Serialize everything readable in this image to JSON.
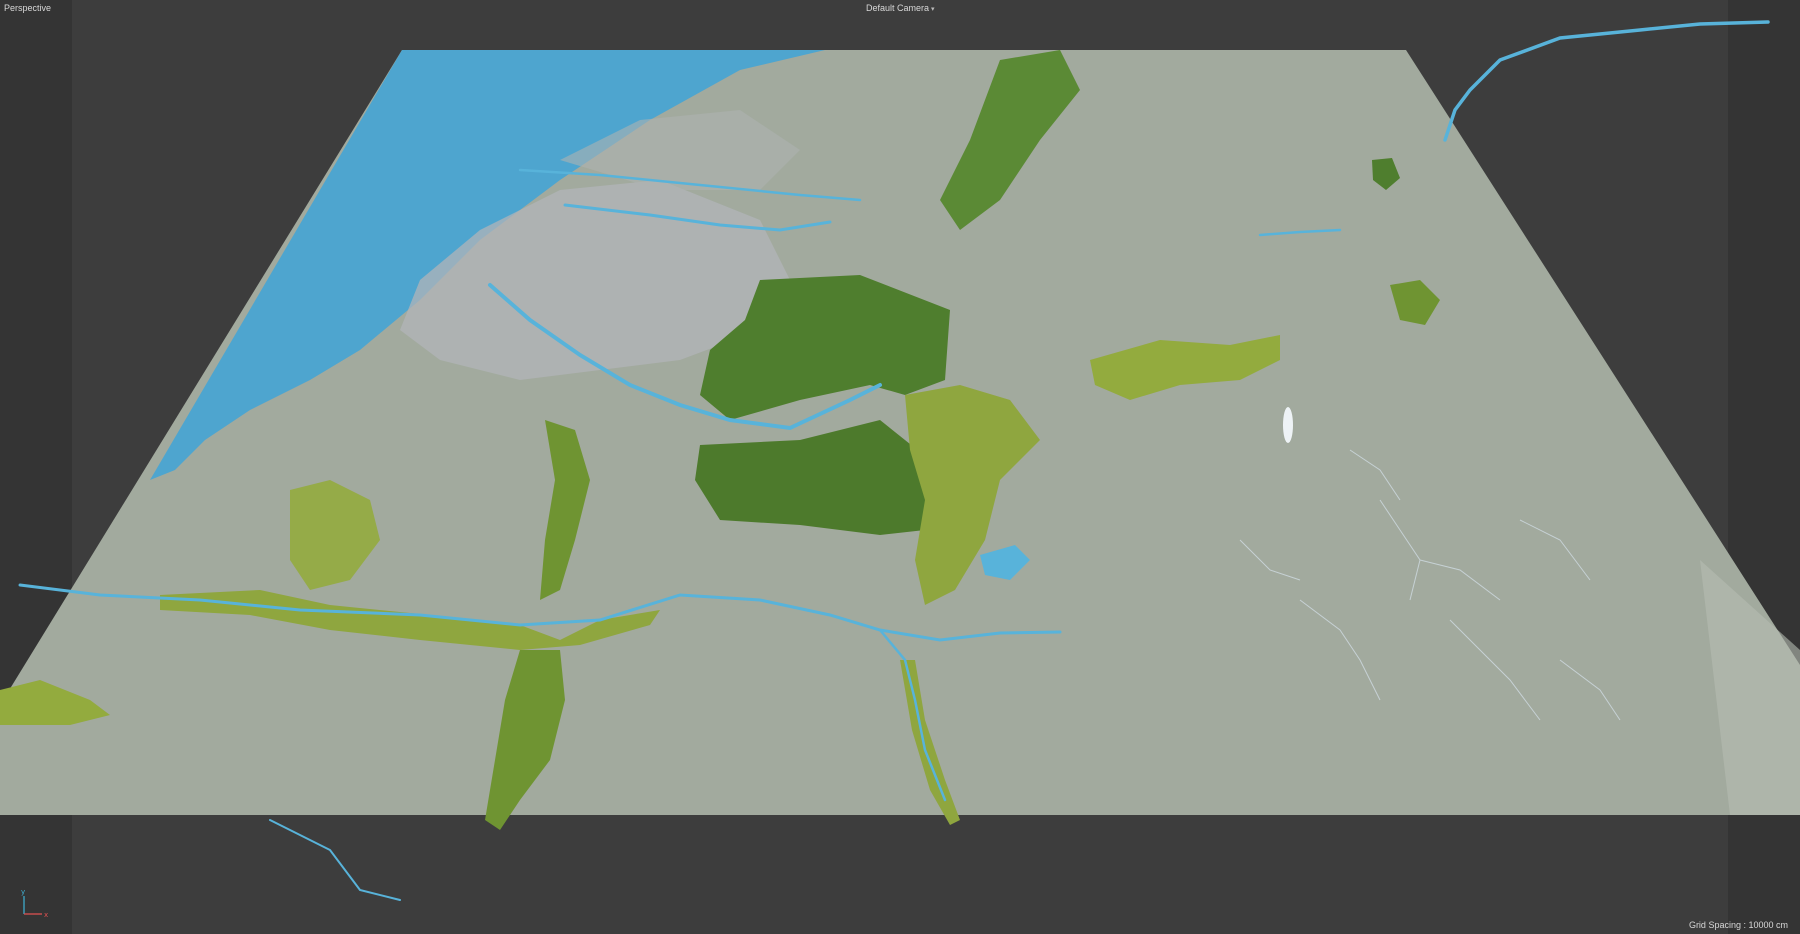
{
  "viewport": {
    "view_name": "Perspective",
    "camera_label": "Default Camera",
    "camera_options": [
      "Default Camera"
    ],
    "grid_spacing_text": "Grid Spacing : 10000 cm"
  },
  "axis_gizmo": {
    "y_label": "y",
    "x_label": "x",
    "y_color": "#3fb3d6",
    "x_color": "#e05050"
  },
  "colors": {
    "background": "#3d3d3d",
    "side_panels": "#343434",
    "terrain_base": "#a2aa9e",
    "water": "#4ea5cf",
    "river": "#58b3da",
    "forest_dark": "#4f7e2e",
    "forest_light": "#93ab3e",
    "urban": "#b2b4b8"
  }
}
